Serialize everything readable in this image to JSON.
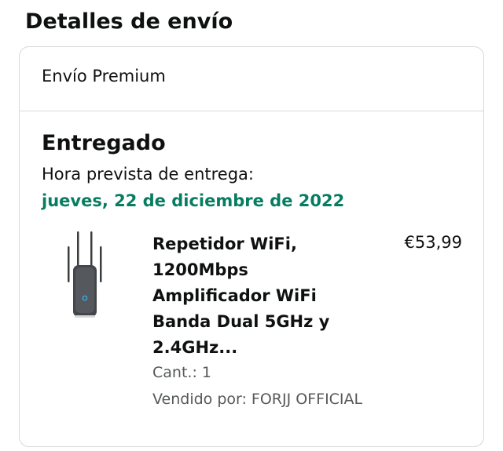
{
  "section_title": "Detalles de envío",
  "shipment": {
    "type": "Envío Premium",
    "status": "Entregado",
    "eta_label": "Hora prevista de entrega:",
    "eta_date": "jueves, 22 de diciembre de 2022"
  },
  "product": {
    "title": "Repetidor WiFi, 1200Mbps Amplificador WiFi Banda Dual 5GHz y 2.4GHz...",
    "price": "€53,99",
    "quantity": "Cant.: 1",
    "seller": "Vendido por: FORJJ OFFICIAL",
    "image_icon": "wifi-repeater-image"
  },
  "colors": {
    "delivery_date": "#067d62",
    "text_primary": "#0f1111",
    "text_secondary": "#565959",
    "border": "#d5d9d9"
  }
}
